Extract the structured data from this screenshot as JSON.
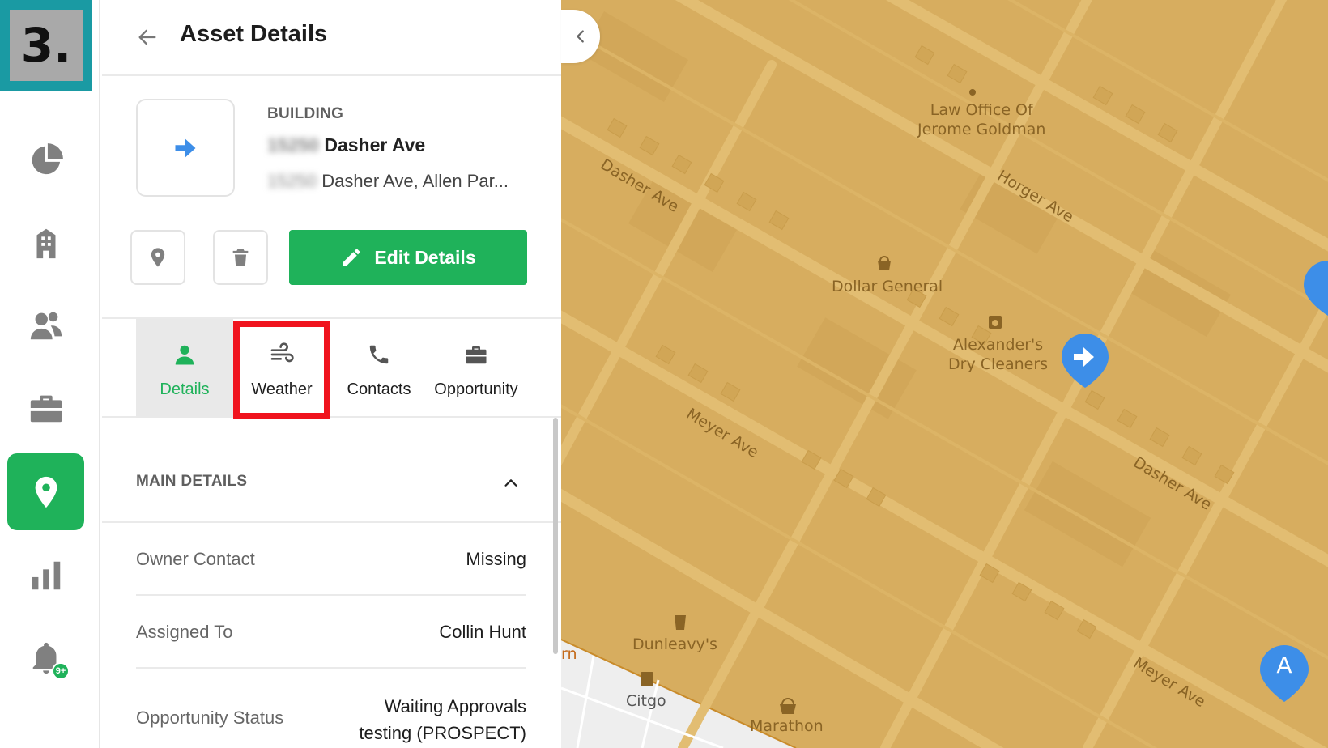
{
  "step_badge": "3.",
  "nav": {
    "notifications_count": "9+"
  },
  "header": {
    "title": "Asset Details"
  },
  "asset": {
    "type": "BUILDING",
    "name_hidden": "15250 ",
    "name": "Dasher Ave",
    "address_hidden": "15250 ",
    "address": "Dasher Ave, Allen Par..."
  },
  "actions": {
    "edit_label": "Edit Details"
  },
  "tabs": [
    {
      "label": "Details",
      "icon": "person-icon"
    },
    {
      "label": "Weather",
      "icon": "wind-icon"
    },
    {
      "label": "Contacts",
      "icon": "phone-icon"
    },
    {
      "label": "Opportunity",
      "icon": "briefcase-icon"
    }
  ],
  "main_details": {
    "title": "MAIN DETAILS",
    "rows": [
      {
        "label": "Owner Contact",
        "value": "Missing"
      },
      {
        "label": "Assigned To",
        "value": "Collin Hunt"
      },
      {
        "label": "Opportunity Status",
        "value_line1": "Waiting Approvals",
        "value_line2": "testing (PROSPECT)"
      }
    ]
  },
  "map": {
    "pois": [
      {
        "line1": "Law Office Of",
        "line2": "Jerome Goldman"
      },
      {
        "line1": "Dollar General"
      },
      {
        "line1": "Alexander's",
        "line2": "Dry Cleaners"
      },
      {
        "line1": "Dunleavy's"
      },
      {
        "line1": "Citgo"
      },
      {
        "line1": "Marathon"
      }
    ],
    "streets": [
      "Dasher Ave",
      "Horger Ave",
      "Meyer Ave",
      "Dasher Ave",
      "Meyer Ave"
    ],
    "partial_label": "rn",
    "marker_letter": "A"
  },
  "colors": {
    "accent": "#1fb25a",
    "highlight": "#f0141e",
    "map_fill": "#d7ad5f",
    "step_badge": "#1a9aa3",
    "marker_blue": "#3d8ee8"
  }
}
